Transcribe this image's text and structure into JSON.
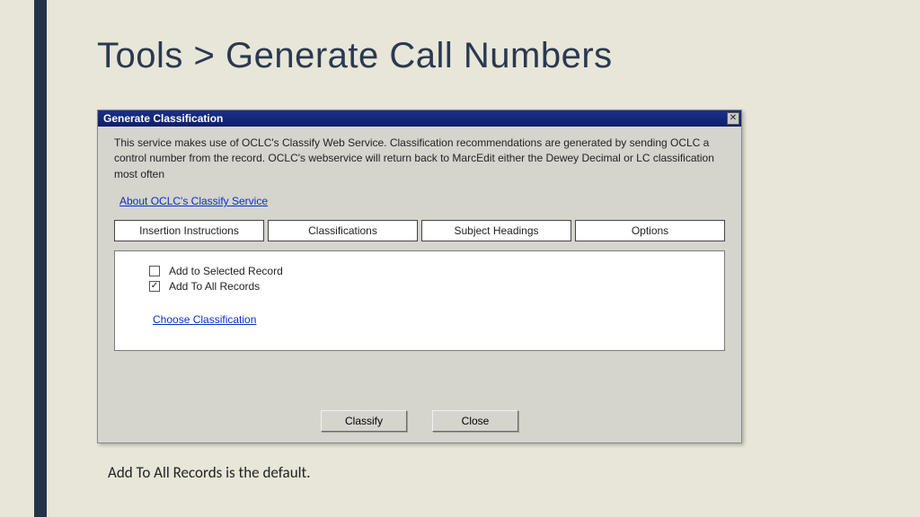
{
  "slide": {
    "title": "Tools > Generate Call Numbers",
    "caption": "Add To All Records is the default."
  },
  "dialog": {
    "title": "Generate Classification",
    "close_glyph": "✕",
    "description": "This service makes use of OCLC's Classify Web Service.  Classification recommendations are generated by sending OCLC a control number from the record.  OCLC's webservice will return back to MarcEdit either the Dewey Decimal or LC classification most often",
    "about_link": "About OCLC's Classify Service",
    "tabs": {
      "t0": "Insertion Instructions",
      "t1": "Classifications",
      "t2": "Subject Headings",
      "t3": "Options"
    },
    "checkboxes": {
      "selected_record": "Add to Selected Record",
      "all_records": "Add To All Records"
    },
    "choose_link": "Choose Classification",
    "buttons": {
      "classify": "Classify",
      "close": "Close"
    }
  }
}
